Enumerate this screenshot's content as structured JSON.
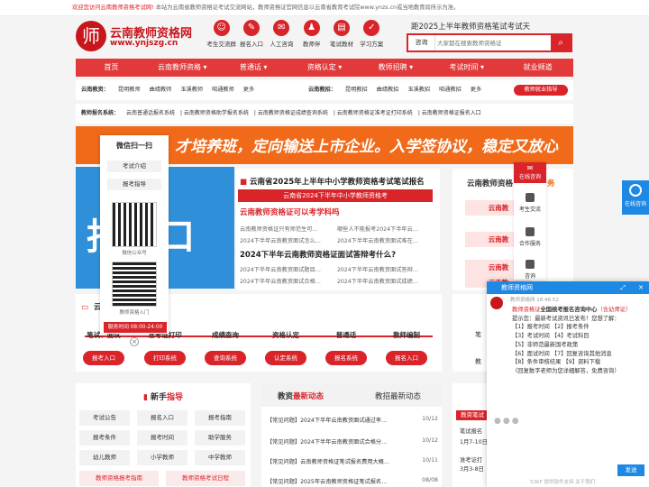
{
  "notice": {
    "welcome": "欢迎您访问云南教师资格考试网!",
    "text": "本站为云南省教师资格证考试交流网站，教师资格证官网信息以云南省教育考试院www.ynzs.cn或当地教育局所示为准。"
  },
  "logo": {
    "mark": "师",
    "name": "云南教师资格网",
    "url": "www.ynjszg.cn"
  },
  "header_icons": [
    {
      "icon": "people-icon",
      "glyph": "☺",
      "label": "考生交流群"
    },
    {
      "icon": "register-icon",
      "glyph": "✎",
      "label": "报名入口"
    },
    {
      "icon": "chat-icon",
      "glyph": "✉",
      "label": "人工咨询"
    },
    {
      "icon": "user-icon",
      "glyph": "♟",
      "label": "教师伴"
    },
    {
      "icon": "book-icon",
      "glyph": "▤",
      "label": "笔试教材"
    },
    {
      "icon": "plan-icon",
      "glyph": "✓",
      "label": "学习方案"
    }
  ],
  "slogan": "距2025上半年教师资格笔试考试天",
  "search": {
    "label": "咨询",
    "placeholder": "大家都在搜索教师资格证",
    "button_glyph": "⌕"
  },
  "nav": [
    "首页",
    "云南教师资格 ▾",
    "普通话 ▾",
    "资格认定 ▾",
    "教师招聘 ▾",
    "考试时间 ▾",
    "就业频道"
  ],
  "cities": {
    "left_title": "云南教资：",
    "left": [
      "昆明教师",
      "曲靖教师",
      "玉溪教师",
      "昭通教师",
      "更多"
    ],
    "right_title": "云南教招：",
    "right": [
      "昆明教招",
      "曲靖教招",
      "玉溪教招",
      "昭通教招",
      "更多"
    ],
    "button": "教师就业指导"
  },
  "systems": {
    "title": "教师报名系统：",
    "items": [
      "云南普通话报名系统",
      "云南教师资格助学报名系统",
      "云南教师资格证成绩查询系统",
      "云南教师资格证准考证打印系统",
      "云南教师资格证报名入口"
    ]
  },
  "banner": {
    "text": "才培养班，定向输送上市企业。入学签协议，稳定又放心"
  },
  "slide": {
    "text": "报入口"
  },
  "news": {
    "headline1": "云南省2025年上半年中小学教师资格考试笔试报名",
    "bar": "云南省2024下半年中小学教师资格考",
    "headline2": "云南教师资格证可以考学科吗",
    "rows1": [
      [
        "云南教师资格证只有师范生可…",
        "哪些人不能报考2024下半年云…"
      ],
      [
        "2024下半年云南教资面试怎么…",
        "2024下半年云南教资面试难在…"
      ]
    ],
    "headline3": "2024下半年云南教师资格证面试答辩考什么?",
    "rows2": [
      [
        "2024下半年云南教资面试题目…",
        "2024下半年云南教资面试答辩…"
      ],
      [
        "2024下半年云南教资面试合格…",
        "2024下半年云南教资面试成绩…"
      ]
    ]
  },
  "rightbox": {
    "title": "云南教师资格",
    "title_tail": "务",
    "buttons": [
      "云南教",
      "云南教",
      "云南教",
      "云南教"
    ]
  },
  "steps": {
    "title": "云",
    "items": [
      {
        "step": "笔试、面试",
        "button": "报考入口"
      },
      {
        "step": "准考证打印",
        "button": "打印系统"
      },
      {
        "step": "成绩查询",
        "button": "查询系统"
      },
      {
        "step": "资格认定",
        "button": "认定系统"
      },
      {
        "step": "普通话",
        "button": "报名系统"
      },
      {
        "step": "教师编制",
        "button": "报名入口"
      }
    ]
  },
  "panel_r": [
    "笔",
    "教"
  ],
  "guide": {
    "title_a": "新手",
    "title_b": "指导",
    "items": [
      "考试公告",
      "报名入口",
      "报考指南",
      "报考条件",
      "报考时间",
      "助学服务",
      "幼儿教师",
      "小学教师",
      "中学教师"
    ],
    "links": [
      "教师资格报考指南",
      "教师资格考试日程"
    ]
  },
  "news2": {
    "tab1_a": "教资",
    "tab1_b": "最新动态",
    "tab2": "教招最新动态",
    "rows": [
      {
        "t": "【常见问题】2024下半年云南教资面试通过率…",
        "d": "10/12"
      },
      {
        "t": "【常见问题】2024下半年云南教资面试合格分…",
        "d": "10/12"
      },
      {
        "t": "【常见问题】云南教师资格证笔试报名费用大概…",
        "d": "10/11"
      },
      {
        "t": "【常见问题】2025年云南教师资格证笔试报名…",
        "d": "08/08"
      }
    ]
  },
  "panel_r2": {
    "tag": "教资笔试",
    "items": [
      "笔试报名",
      "1月7-10日",
      "准考证打",
      "3月3-8日"
    ]
  },
  "wechat": {
    "title": "微信扫一扫",
    "btn1": "考试介绍",
    "btn2": "报考指导",
    "cap1": "微信公众号",
    "cap2": "教师资格入门",
    "hours": "服务时间 08:00-24:00"
  },
  "sidebar": {
    "top": "在线咨询",
    "items": [
      "考生交流",
      "合作服务",
      "咨询"
    ]
  },
  "online": {
    "label": "在线咨询"
  },
  "chat": {
    "title": "教师资格网",
    "meta": "教师资格网 18:46:52",
    "line1a": "教师资格证",
    "line1b": "全国统考报名咨询中心",
    "line1c": "（含幼师证）",
    "line2": "提示您：最新考试资讯已发布！您想了解：",
    "opts": [
      "【1】报考时间 【2】报考条件",
      "【3】考试时间 【4】考试科目",
      "【5】非师范最新国考政策",
      "【6】面试时间 【7】回复咨询其他消息",
      "【8】条件审核结果 【9】资料下载",
      "（回复数字老师为您详细解答，免费咨询）"
    ],
    "send": "发送",
    "foot": "53KF 提供软件支持 关于我们"
  }
}
